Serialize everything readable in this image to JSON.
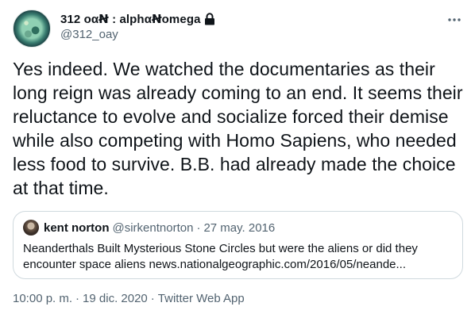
{
  "author": {
    "display_name": "312 οαꞤ : alphαꞤomega",
    "handle": "@312_oay"
  },
  "tweet": {
    "text": "Yes indeed. We watched the documentaries as their long reign was already coming to an end. It seems their reluctance to evolve and socialize forced their demise while also competing with Homo Sapiens, who needed less food to survive. B.B. had already made the choice at that time."
  },
  "quote": {
    "name": "kent norton",
    "handle": "@sirkentnorton",
    "separator": "·",
    "date": "27 may. 2016",
    "text": "Neanderthals Built Mysterious Stone Circles but were the aliens or did they encounter space aliens news.nationalgeographic.com/2016/05/neande..."
  },
  "meta": {
    "time": "10:00 p. m.",
    "separator": "·",
    "date": "19 dic. 2020",
    "source": "Twitter Web App"
  },
  "icons": {
    "lock": "lock-icon",
    "more": "more-options-icon"
  },
  "colors": {
    "text": "#0f1419",
    "secondary": "#536471",
    "border": "#cfd9de"
  }
}
